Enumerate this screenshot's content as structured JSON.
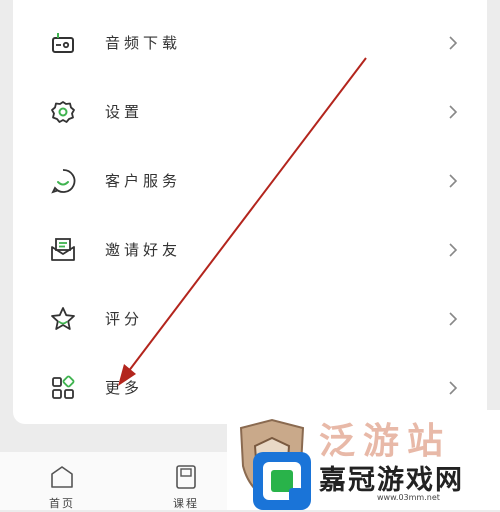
{
  "menu": {
    "items": [
      {
        "label": "音频下载",
        "icon": "radio-icon"
      },
      {
        "label": "设置",
        "icon": "gear-icon"
      },
      {
        "label": "客户服务",
        "icon": "chat-smile-icon"
      },
      {
        "label": "邀请好友",
        "icon": "mail-invite-icon"
      },
      {
        "label": "评分",
        "icon": "star-icon"
      },
      {
        "label": "更多",
        "icon": "grid-more-icon"
      }
    ]
  },
  "tabbar": {
    "tabs": [
      {
        "label": "首页",
        "icon": "home-icon"
      },
      {
        "label": "课程",
        "icon": "book-icon"
      }
    ]
  },
  "watermark": {
    "ghost_text": "泛游站",
    "brand": "嘉冠游戏网",
    "url": "www.03mm.net"
  },
  "colors": {
    "accent": "#3fb34f",
    "arrow": "#b3251d",
    "icon_stroke": "#333333"
  }
}
